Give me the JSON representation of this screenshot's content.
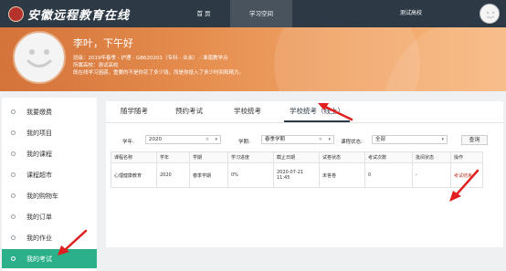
{
  "header": {
    "logo_text": "安徽远程教育在线",
    "nav": {
      "home": "首 页",
      "study": "学习空间",
      "school": "测试高校"
    }
  },
  "banner": {
    "greeting": "李叶，下午好",
    "info": [
      "班级：2019年春季 - 护理 - GB620201（专科 - 业余） - 淮南教学点",
      "所属高校：测试高校",
      "既在线学习困惑，重要的不是你花了多少钱，而是你投入了多少时间和精力。"
    ]
  },
  "sidebar": {
    "items": [
      {
        "label": "我要缴费"
      },
      {
        "label": "我的项目"
      },
      {
        "label": "我的课程"
      },
      {
        "label": "课程超市"
      },
      {
        "label": "我的购物车"
      },
      {
        "label": "我的订单"
      },
      {
        "label": "我的作业"
      },
      {
        "label": "我的考试",
        "active": true
      }
    ]
  },
  "tabs": [
    {
      "label": "随学随考"
    },
    {
      "label": "预约考试"
    },
    {
      "label": "学校统考"
    },
    {
      "label": "学校统考（线上）",
      "active": true
    }
  ],
  "filters": {
    "year_label": "学年:",
    "year_value": "2020",
    "term_label": "学期:",
    "term_value": "春季学期",
    "status_label": "课程状态:",
    "status_value": "全部",
    "clear_symbol": "×",
    "caret_symbol": "▾",
    "query_button": "查询"
  },
  "table": {
    "columns": [
      "课程名称",
      "学年",
      "学期",
      "学习进度",
      "截止日期",
      "试卷状态",
      "考试次数",
      "批阅状态",
      "操作"
    ],
    "rows": [
      {
        "course": "心理健康教育",
        "year": "2020",
        "term": "春季学期",
        "progress": "0%",
        "deadline": "2020-07-21 11:45",
        "paper_status": "未答卷",
        "attempts": "0",
        "review_status": "-",
        "action": "考试结束"
      }
    ]
  },
  "colors": {
    "topbar": "#2d3a46",
    "accent_green": "#2bb08a",
    "banner_orange": "#e38a4c",
    "annotation_red": "#e02020",
    "link_red": "#c0392b"
  },
  "icons": {
    "logo": "school-seal-icon",
    "avatar": "smiley-avatar-icon",
    "sidebar_bullet": "circle-icon",
    "clear": "clear-x-icon",
    "caret": "caret-down-icon",
    "annotation": "red-arrow-icon"
  }
}
